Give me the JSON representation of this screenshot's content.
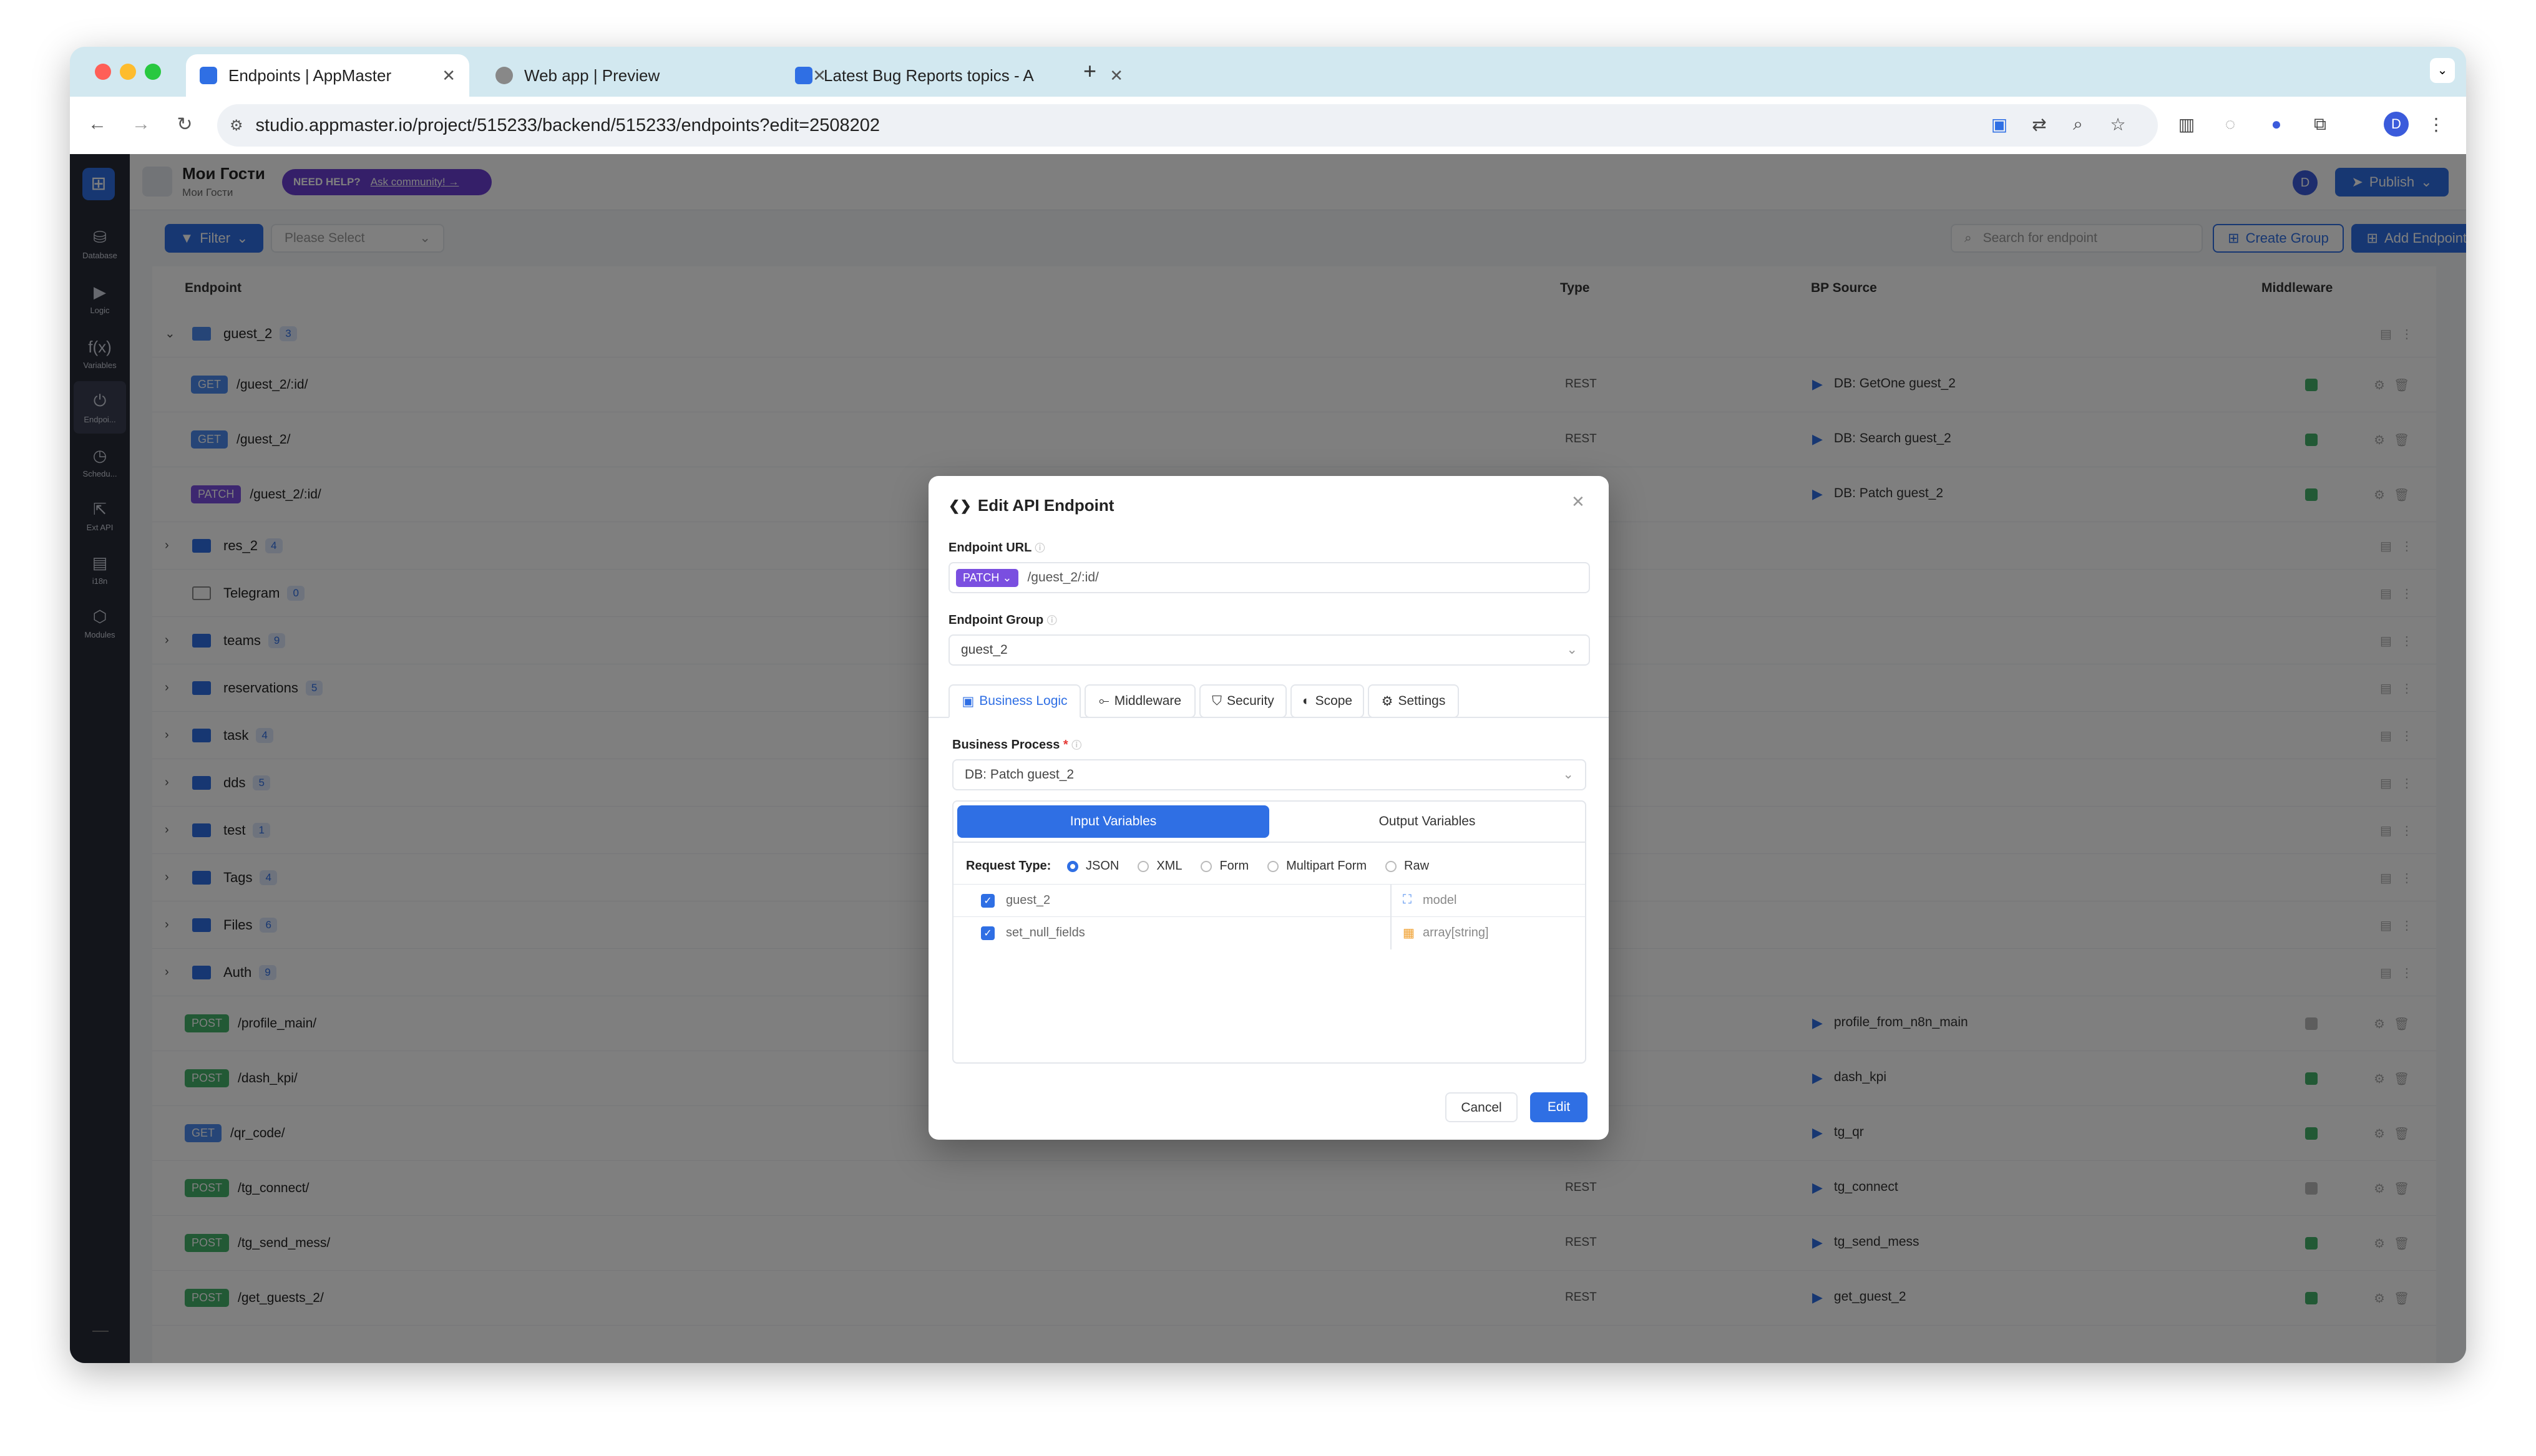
{
  "browser": {
    "tabs": [
      {
        "title": "Endpoints | AppMaster"
      },
      {
        "title": "Web app | Preview"
      },
      {
        "title": "Latest Bug Reports topics - A"
      }
    ],
    "new_tab_symbol": "+",
    "url": "studio.appmaster.io/project/515233/backend/515233/endpoints?edit=2508202",
    "profile_initial": "D"
  },
  "sidebar": {
    "items": [
      {
        "label": "Database",
        "icon": "database-icon"
      },
      {
        "label": "Logic",
        "icon": "logic-icon"
      },
      {
        "label": "Variables",
        "icon": "function-icon",
        "glyph": "f(x)"
      },
      {
        "label": "Endpoi...",
        "icon": "plug-icon"
      },
      {
        "label": "Schedu...",
        "icon": "clock-icon"
      },
      {
        "label": "Ext API",
        "icon": "external-icon"
      },
      {
        "label": "i18n",
        "icon": "translate-icon"
      },
      {
        "label": "Modules",
        "icon": "modules-icon"
      }
    ]
  },
  "header": {
    "project_name": "Мои Гости",
    "project_sub": "Мои Гости",
    "need_help": "NEED HELP?",
    "ask_community": "Ask community! →",
    "avatar": "D",
    "publish": "Publish"
  },
  "toolbar": {
    "filter": "Filter",
    "select_placeholder": "Please Select",
    "search_placeholder": "Search for endpoint",
    "create_group": "Create Group",
    "add_endpoint": "Add Endpoint"
  },
  "table": {
    "headers": {
      "endpoint": "Endpoint",
      "type": "Type",
      "bp_source": "BP Source",
      "middleware": "Middleware"
    },
    "open_group": {
      "name": "guest_2",
      "count": "3"
    },
    "group_endpoints": [
      {
        "method": "GET",
        "path": "/guest_2/:id/",
        "type": "REST",
        "bp": "DB: GetOne guest_2"
      },
      {
        "method": "GET",
        "path": "/guest_2/",
        "type": "REST",
        "bp": "DB: Search guest_2"
      },
      {
        "method": "PATCH",
        "path": "/guest_2/:id/",
        "type": "REST",
        "bp": "DB: Patch guest_2"
      }
    ],
    "groups": [
      {
        "name": "res_2",
        "count": "4"
      },
      {
        "name": "Telegram",
        "count": "0"
      },
      {
        "name": "teams",
        "count": "9"
      },
      {
        "name": "reservations",
        "count": "5"
      },
      {
        "name": "task",
        "count": "4"
      },
      {
        "name": "dds",
        "count": "5"
      },
      {
        "name": "test",
        "count": "1"
      },
      {
        "name": "Tags",
        "count": "4"
      },
      {
        "name": "Files",
        "count": "6"
      },
      {
        "name": "Auth",
        "count": "9"
      }
    ],
    "root_endpoints": [
      {
        "method": "POST",
        "path": "/profile_main/",
        "type": "",
        "bp": "profile_from_n8n_main"
      },
      {
        "method": "POST",
        "path": "/dash_kpi/",
        "type": "REST",
        "bp": "dash_kpi"
      },
      {
        "method": "GET",
        "path": "/qr_code/",
        "type": "REST",
        "bp": "tg_qr"
      },
      {
        "method": "POST",
        "path": "/tg_connect/",
        "type": "REST",
        "bp": "tg_connect"
      },
      {
        "method": "POST",
        "path": "/tg_send_mess/",
        "type": "REST",
        "bp": "tg_send_mess"
      },
      {
        "method": "POST",
        "path": "/get_guests_2/",
        "type": "REST",
        "bp": "get_guest_2"
      }
    ]
  },
  "modal": {
    "title": "Edit API Endpoint",
    "url_label": "Endpoint URL",
    "method": "PATCH",
    "url_value": "/guest_2/:id/",
    "group_label": "Endpoint Group",
    "group_value": "guest_2",
    "tabs": [
      "Business Logic",
      "Middleware",
      "Security",
      "Scope",
      "Settings"
    ],
    "bp_label": "Business Process",
    "required_mark": "*",
    "bp_value": "DB: Patch guest_2",
    "var_tabs": {
      "input": "Input Variables",
      "output": "Output Variables"
    },
    "request_type_label": "Request Type:",
    "request_types": [
      "JSON",
      "XML",
      "Form",
      "Multipart Form",
      "Raw"
    ],
    "selected_request_type": "JSON",
    "variables": [
      {
        "name": "guest_2",
        "type": "model"
      },
      {
        "name": "set_null_fields",
        "type": "array[string]"
      }
    ],
    "cancel": "Cancel",
    "edit": "Edit"
  }
}
